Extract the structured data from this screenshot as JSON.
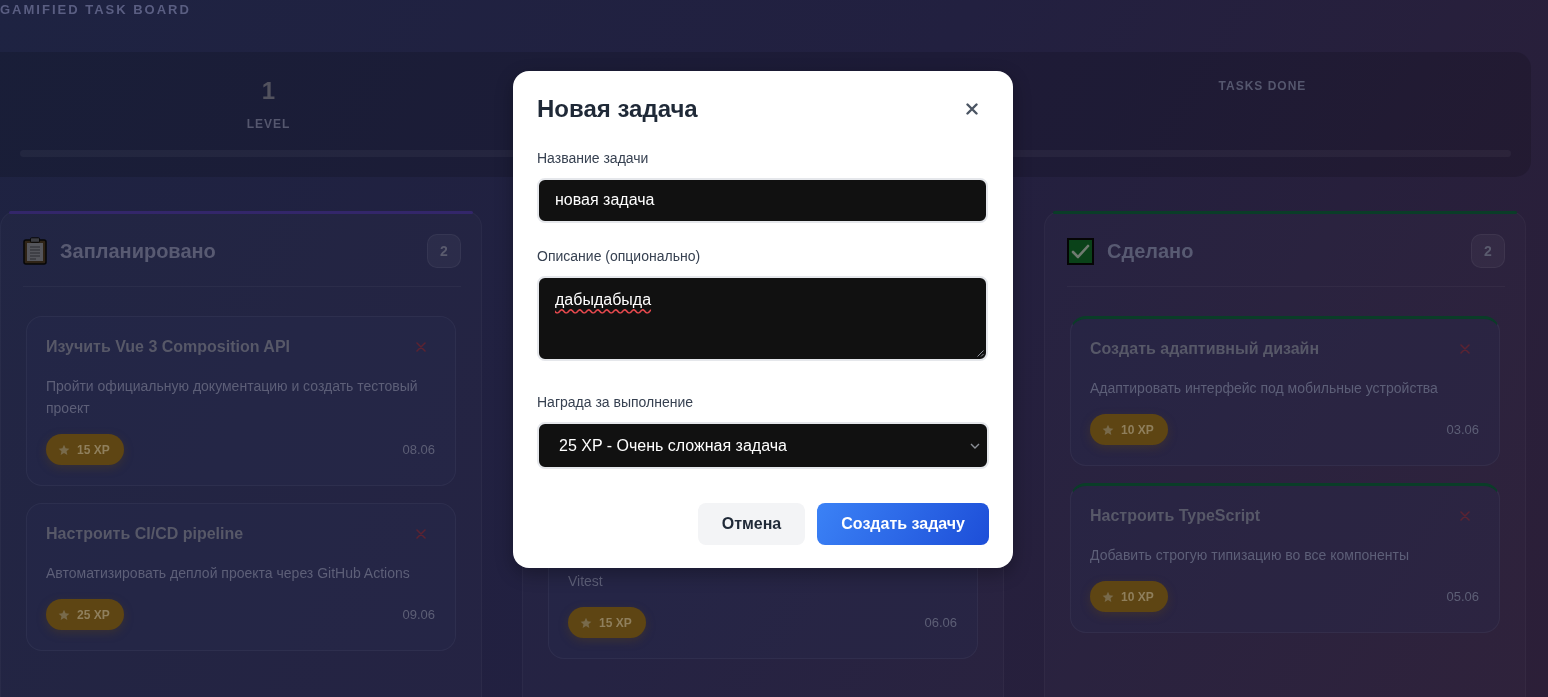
{
  "app": {
    "title": "GAMIFIED TASK BOARD"
  },
  "stats": {
    "items": [
      {
        "value": "1",
        "label": "LEVEL"
      },
      {
        "label": "TASKS DONE"
      }
    ],
    "progress": {
      "level": 0
    }
  },
  "columns": [
    {
      "kind": "planned",
      "title": "Запланировано",
      "count": "2",
      "color": "#33266a",
      "cards": [
        {
          "title": "Изучить Vue 3 Composition API",
          "description": "Пройти официальную документацию и создать тестовый проект",
          "xp": "15 XP",
          "date": "08.06"
        },
        {
          "title": "Настроить CI/CD pipeline",
          "description": "Автоматизировать деплой проекта через GitHub Actions",
          "xp": "25 XP",
          "date": "09.06"
        }
      ]
    },
    {
      "kind": "in_progress",
      "cards": [
        {
          "description": "Vitest",
          "xp": "15 XP",
          "date": "06.06"
        }
      ]
    },
    {
      "kind": "done",
      "title": "Сделано",
      "count": "2",
      "color": "#0a3d28",
      "cards": [
        {
          "title": "Создать адаптивный дизайн",
          "description": "Адаптировать интерфейс под мобильные устройства",
          "xp": "10 XP",
          "date": "03.06"
        },
        {
          "title": "Настроить TypeScript",
          "description": "Добавить строгую типизацию во все компоненты",
          "xp": "10 XP",
          "date": "05.06"
        }
      ]
    }
  ],
  "modal": {
    "title": "Новая задача",
    "fields": [
      {
        "kind": "input",
        "label": "Название задачи",
        "value": "новая задача"
      },
      {
        "kind": "textarea",
        "label": "Описание (опционально)",
        "value": "дабыдабыда",
        "spellcheck_error": true
      },
      {
        "kind": "select",
        "label": "Награда за выполнение",
        "value": "25 XP - Очень сложная задача"
      }
    ],
    "buttons": [
      {
        "kind": "secondary",
        "label": "Отмена"
      },
      {
        "kind": "primary",
        "label": "Создать задачу"
      }
    ]
  }
}
